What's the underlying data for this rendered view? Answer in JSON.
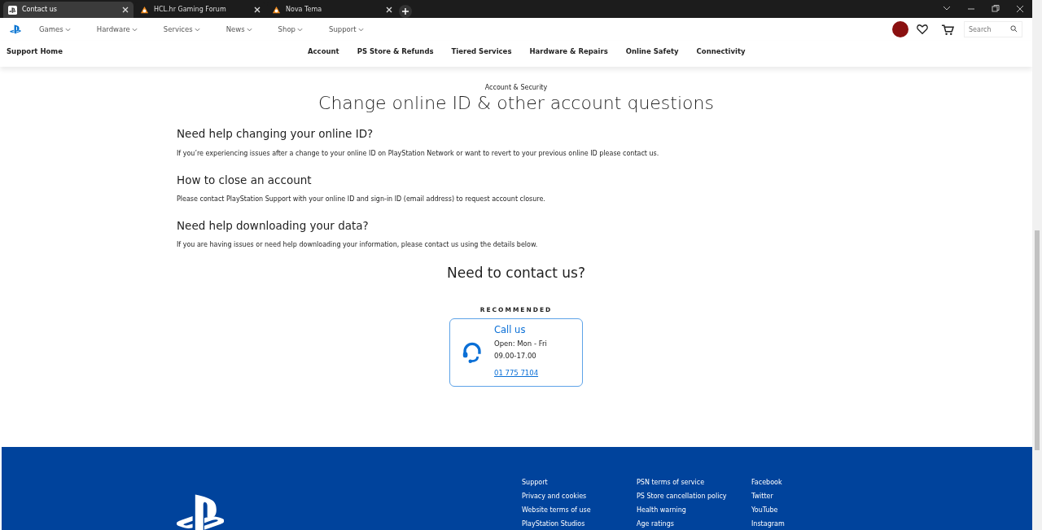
{
  "browser_tabs": [
    {
      "title": "Contact us",
      "selected": true,
      "kind": "ps"
    },
    {
      "title": "HCL.hr Gaming Forum",
      "selected": false,
      "kind": "hcl"
    },
    {
      "title": "Nova Tema",
      "selected": false,
      "kind": "hcl"
    }
  ],
  "nav": {
    "items": [
      "Games",
      "Hardware",
      "Services",
      "News",
      "Shop",
      "Support"
    ],
    "search": {
      "placeholder": "Search"
    }
  },
  "subnav": {
    "home": "Support Home",
    "items": [
      "Account",
      "PS Store & Refunds",
      "Tiered Services",
      "Hardware & Repairs",
      "Online Safety",
      "Connectivity"
    ]
  },
  "page": {
    "eyebrow": "Account & Security",
    "title": "Change online ID & other account questions",
    "sections": [
      {
        "heading": "Need help changing your online ID?",
        "text": "If you’re experiencing issues after a change to your online ID on PlayStation Network or want to revert to your previous online ID please contact us."
      },
      {
        "heading": "How to close an account",
        "text": "Please contact PlayStation Support with your online ID and sign-in ID (email address) to request account closure."
      },
      {
        "heading": "Need help downloading your data?",
        "text": "If you are having issues or need help downloading your information, please contact us using the details below."
      }
    ],
    "contact_heading": "Need to contact us?",
    "contact_card": {
      "badge": "RECOMMENDED",
      "title": "Call us",
      "lines": [
        "Open: Mon - Fri",
        "09.00-17.00"
      ],
      "phone": "01 775 7104"
    }
  },
  "footer": {
    "columns": [
      [
        "Support",
        "Privacy and cookies",
        "Website terms of use",
        "PlayStation Studios"
      ],
      [
        "PSN terms of service",
        "PS Store cancellation policy",
        "Health warning",
        "Age ratings"
      ],
      [
        "Facebook",
        "Twitter",
        "YouTube",
        "Instagram"
      ]
    ]
  }
}
